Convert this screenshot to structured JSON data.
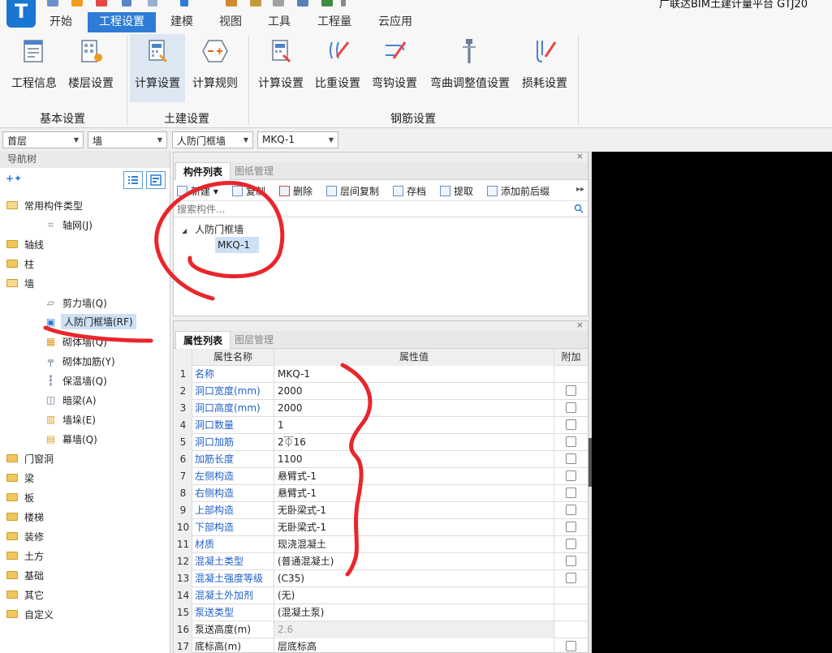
{
  "window": {
    "title": "广联达BIM土建计量平台 GTJ20"
  },
  "menu": {
    "tabs": [
      "开始",
      "工程设置",
      "建模",
      "视图",
      "工具",
      "工程量",
      "云应用"
    ],
    "active_index": 1
  },
  "ribbon": {
    "buttons": [
      "工程信息",
      "楼层设置",
      "计算设置",
      "计算规则",
      "计算设置",
      "比重设置",
      "弯钩设置",
      "弯曲调整值设置",
      "损耗设置"
    ],
    "groups": [
      "基本设置",
      "土建设置",
      "钢筋设置"
    ]
  },
  "selectors": [
    "首层",
    "墙",
    "人防门框墙",
    "MKQ-1"
  ],
  "nav": {
    "title": "导航树",
    "tree": [
      "常用构件类型",
      "轴网(J)",
      "轴线",
      "柱",
      "墙",
      "剪力墙(Q)",
      "人防门框墙(RF)",
      "砌体墙(Q)",
      "砌体加筋(Y)",
      "保温墙(Q)",
      "暗梁(A)",
      "墙垛(E)",
      "幕墙(Q)",
      "门窗洞",
      "梁",
      "板",
      "楼梯",
      "装修",
      "土方",
      "基础",
      "其它",
      "自定义"
    ],
    "selected_index": 6
  },
  "component_list": {
    "tabs": [
      "构件列表",
      "图纸管理"
    ],
    "toolbar": [
      "新建",
      "复制",
      "删除",
      "层间复制",
      "存档",
      "提取",
      "添加前后缀"
    ],
    "search_placeholder": "搜索构件...",
    "tree_root": "人防门框墙",
    "tree_item": "MKQ-1"
  },
  "property_list": {
    "tabs": [
      "属性列表",
      "图层管理"
    ],
    "headers": [
      "属性名称",
      "属性值",
      "附加"
    ],
    "rows": [
      {
        "n": "1",
        "name": "名称",
        "value": "MKQ-1",
        "check": false,
        "checked": false
      },
      {
        "n": "2",
        "name": "洞口宽度(mm)",
        "value": "2000",
        "check": true,
        "checked": false
      },
      {
        "n": "3",
        "name": "洞口高度(mm)",
        "value": "2000",
        "check": true,
        "checked": false
      },
      {
        "n": "4",
        "name": "洞口数量",
        "value": "1",
        "check": true,
        "checked": false
      },
      {
        "n": "5",
        "name": "洞口加筋",
        "value": "2⏁16",
        "check": true,
        "checked": false
      },
      {
        "n": "6",
        "name": "加筋长度",
        "value": "1100",
        "check": true,
        "checked": false
      },
      {
        "n": "7",
        "name": "左侧构造",
        "value": "悬臂式-1",
        "check": true,
        "checked": false
      },
      {
        "n": "8",
        "name": "右侧构造",
        "value": "悬臂式-1",
        "check": true,
        "checked": false
      },
      {
        "n": "9",
        "name": "上部构造",
        "value": "无卧梁式-1",
        "check": true,
        "checked": false
      },
      {
        "n": "10",
        "name": "下部构造",
        "value": "无卧梁式-1",
        "check": true,
        "checked": false
      },
      {
        "n": "11",
        "name": "材质",
        "value": "现浇混凝土",
        "check": true,
        "checked": false
      },
      {
        "n": "12",
        "name": "混凝土类型",
        "value": "(普通混凝土)",
        "check": true,
        "checked": false
      },
      {
        "n": "13",
        "name": "混凝土强度等级",
        "value": "(C35)",
        "check": true,
        "checked": false
      },
      {
        "n": "14",
        "name": "混凝土外加剂",
        "value": "(无)",
        "check": false,
        "checked": false
      },
      {
        "n": "15",
        "name": "泵送类型",
        "value": "(混凝土泵)",
        "check": false,
        "checked": false
      },
      {
        "n": "16",
        "name": "泵送高度(m)",
        "value": "2.6",
        "check": false,
        "checked": false
      },
      {
        "n": "17",
        "name": "底标高(m)",
        "value": "层底标高",
        "check": true,
        "checked": false
      }
    ]
  },
  "colors": {
    "accent": "#2e7cd6",
    "link_text": "#2060c8",
    "annotation": "#e8262c",
    "canvas": "#000000"
  }
}
